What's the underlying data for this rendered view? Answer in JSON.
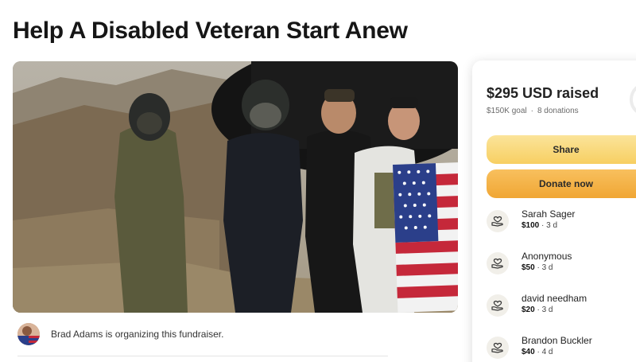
{
  "page": {
    "title": "Help A Disabled Veteran Start Anew"
  },
  "organizer": {
    "text": "Brad Adams is organizing this fundraiser."
  },
  "summary": {
    "raised": "$295 USD raised",
    "goal": "$150K goal",
    "donations_count": "8 donations"
  },
  "actions": {
    "share_label": "Share",
    "donate_label": "Donate now"
  },
  "donations": [
    {
      "name": "Sarah Sager",
      "amount": "$100",
      "time": "3 d"
    },
    {
      "name": "Anonymous",
      "amount": "$50",
      "time": "3 d"
    },
    {
      "name": "david needham",
      "amount": "$20",
      "time": "3 d"
    },
    {
      "name": "Brandon Buckler",
      "amount": "$40",
      "time": "4 d"
    }
  ],
  "icons": {
    "donation": "heart-hand-icon"
  },
  "colors": {
    "share_button": "#f7cf62",
    "donate_button": "#f0a634"
  }
}
